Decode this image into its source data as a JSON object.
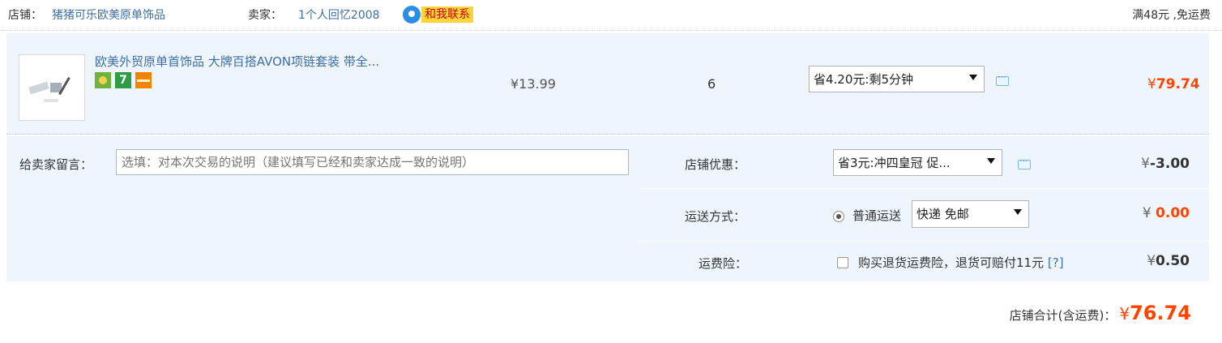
{
  "shop": {
    "label": "店铺：",
    "name": "猪猪可乐欧美原单饰品",
    "seller_label": "卖家：",
    "seller_name": "1个人回忆2008",
    "contact_label": "和我联系",
    "free_shipping_note": "满48元 ,免运费"
  },
  "item": {
    "title": "欧美外贸原单首饰品 大牌百搭AVON项链套装 带全...",
    "badge_icons": [
      "green-shop-icon",
      "seven-day-return-icon",
      "credit-card-icon"
    ],
    "badge_7": "7",
    "unit_price": "¥13.99",
    "quantity": "6",
    "discount_select": "省4.20元:剩5分钟",
    "subtotal_symbol": "¥",
    "subtotal_value": "79.74"
  },
  "details": {
    "note_label": "给卖家留言：",
    "note_placeholder": "选填：对本次交易的说明（建议填写已经和卖家达成一致的说明）",
    "shop_discount_label": "店铺优惠：",
    "shop_discount_select": "省3元:冲四皇冠 促...",
    "shop_discount_symbol": "¥",
    "shop_discount_value": "-3.00",
    "shipping_label": "运送方式：",
    "shipping_option": "普通运送",
    "shipping_select": "快递 免邮",
    "shipping_symbol": "¥ ",
    "shipping_value": "0.00",
    "insurance_label": "运费险：",
    "insurance_text": "购买退货运费险，退货可赔付11元",
    "insurance_help": "[?]",
    "insurance_symbol": "¥",
    "insurance_value": "0.50"
  },
  "total": {
    "label": "店铺合计(含运费)：",
    "symbol": "¥",
    "value": "76.74"
  },
  "colors": {
    "accent_orange": "#ff4400",
    "link_blue": "#3c6fa3",
    "row_bg": "#eff5fc"
  }
}
